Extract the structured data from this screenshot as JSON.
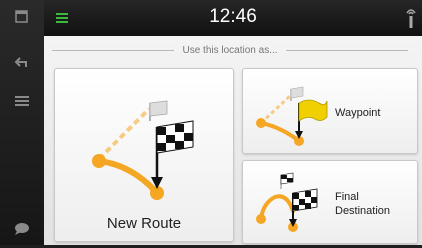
{
  "status_bar": {
    "time": "12:46"
  },
  "dialog": {
    "heading": "Use this location as...",
    "options": {
      "new_route": "New Route",
      "waypoint": "Waypoint",
      "final_destination_line1": "Final",
      "final_destination_line2": "Destination"
    }
  },
  "sidebar": {
    "icons": [
      "map-view-icon",
      "back-arrow-icon",
      "menu-icon",
      "speech-bubble-icon"
    ]
  },
  "status_icons": [
    "signal-bars-icon",
    "gps-antenna-icon"
  ],
  "colors": {
    "route": "#f5a623",
    "flag_yellow": "#f0d000",
    "signal_green": "#3cba3c"
  }
}
